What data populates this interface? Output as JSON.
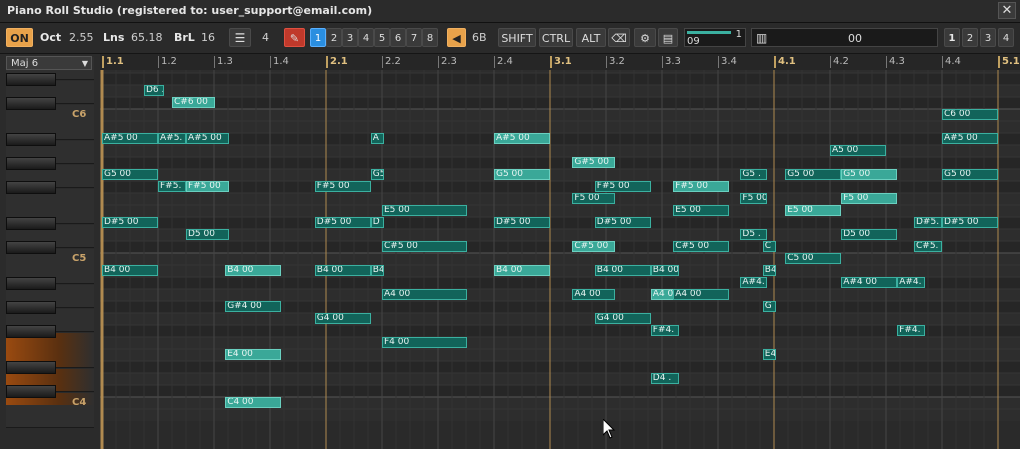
{
  "window": {
    "title": "Piano Roll Studio  (registered to: user_support@email.com)",
    "close_glyph": "✕"
  },
  "toolbar": {
    "on_label": "ON",
    "oct_label": "Oct",
    "oct_value": "2.55",
    "lns_label": "Lns",
    "lns_value": "65.18",
    "brl_label": "BrL",
    "brl_value": "16",
    "lanes_value": "4",
    "pencil_icon": "pencil-icon",
    "tracks": [
      "1",
      "2",
      "3",
      "4",
      "5",
      "6",
      "7",
      "8"
    ],
    "selected_track": "1",
    "speaker_value": "6B",
    "modifiers": [
      "SHIFT",
      "CTRL",
      "ALT"
    ],
    "position_value": "09",
    "position_top": "1",
    "pattern_value": "00",
    "views": [
      "1",
      "2",
      "3",
      "4"
    ],
    "selected_view": "1"
  },
  "keyboard": {
    "scale": "Maj 6",
    "labels": [
      "C6",
      "C5",
      "C4"
    ]
  },
  "ruler": [
    "1.1",
    "1.2",
    "1.3",
    "1.4",
    "2.1",
    "2.2",
    "2.3",
    "2.4",
    "3.1",
    "3.2",
    "3.3",
    "3.4",
    "4.1",
    "4.2",
    "4.3",
    "4.4",
    "5.1"
  ],
  "notes": [
    {
      "label": "D6 .",
      "pitch": "D6",
      "start": 1.1875,
      "len": 0.09
    },
    {
      "label": "C#6 00",
      "pitch": "C#6",
      "start": 1.3125,
      "len": 0.19
    },
    {
      "label": "C6 00",
      "pitch": "C6",
      "start": 4.75,
      "len": 0.25
    },
    {
      "label": "A#5 00",
      "pitch": "A#5",
      "start": 1.0,
      "len": 0.25
    },
    {
      "label": "A#5.",
      "pitch": "A#5",
      "start": 1.25,
      "len": 0.125
    },
    {
      "label": "A#5 00",
      "pitch": "A#5",
      "start": 1.375,
      "len": 0.19
    },
    {
      "label": "A",
      "pitch": "A#5",
      "start": 2.2,
      "len": 0.06
    },
    {
      "label": "A#5 00",
      "pitch": "A#5",
      "start": 2.75,
      "len": 0.25
    },
    {
      "label": "A#5 00",
      "pitch": "A#5",
      "start": 4.75,
      "len": 0.25
    },
    {
      "label": "A5 00",
      "pitch": "A5",
      "start": 4.25,
      "len": 0.25
    },
    {
      "label": "G#5 00",
      "pitch": "G#5",
      "start": 3.1,
      "len": 0.19
    },
    {
      "label": "G5 00",
      "pitch": "G5",
      "start": 1.0,
      "len": 0.25
    },
    {
      "label": "G5",
      "pitch": "G5",
      "start": 2.2,
      "len": 0.06
    },
    {
      "label": "G5 00",
      "pitch": "G5",
      "start": 2.75,
      "len": 0.25
    },
    {
      "label": "G5 .",
      "pitch": "G5",
      "start": 3.85,
      "len": 0.12
    },
    {
      "label": "G5 00",
      "pitch": "G5",
      "start": 4.05,
      "len": 0.25
    },
    {
      "label": "G5 00",
      "pitch": "G5",
      "start": 4.3,
      "len": 0.25
    },
    {
      "label": "G5 00",
      "pitch": "G5",
      "start": 4.75,
      "len": 0.25
    },
    {
      "label": "F#5.",
      "pitch": "F#5",
      "start": 1.25,
      "len": 0.125
    },
    {
      "label": "F#5 00",
      "pitch": "F#5",
      "start": 1.375,
      "len": 0.19
    },
    {
      "label": "F#5 00",
      "pitch": "F#5",
      "start": 1.95,
      "len": 0.25
    },
    {
      "label": "F#5 00",
      "pitch": "F#5",
      "start": 3.2,
      "len": 0.25
    },
    {
      "label": "F#5 00",
      "pitch": "F#5",
      "start": 3.55,
      "len": 0.25
    },
    {
      "label": "F5 00",
      "pitch": "F5",
      "start": 3.1,
      "len": 0.19
    },
    {
      "label": "F5 00",
      "pitch": "F5",
      "start": 3.85,
      "len": 0.12
    },
    {
      "label": "F5 00",
      "pitch": "F5",
      "start": 4.3,
      "len": 0.25
    },
    {
      "label": "E5 00",
      "pitch": "E5",
      "start": 2.25,
      "len": 0.38
    },
    {
      "label": "E5 00",
      "pitch": "E5",
      "start": 3.55,
      "len": 0.25
    },
    {
      "label": "E5 00",
      "pitch": "E5",
      "start": 4.05,
      "len": 0.25
    },
    {
      "label": "D#5 00",
      "pitch": "D#5",
      "start": 1.0,
      "len": 0.25
    },
    {
      "label": "D#5 00",
      "pitch": "D#5",
      "start": 1.95,
      "len": 0.25
    },
    {
      "label": "D",
      "pitch": "D#5",
      "start": 2.2,
      "len": 0.06
    },
    {
      "label": "D#5 00",
      "pitch": "D#5",
      "start": 2.75,
      "len": 0.25
    },
    {
      "label": "D#5 00",
      "pitch": "D#5",
      "start": 3.2,
      "len": 0.25
    },
    {
      "label": "D#5.",
      "pitch": "D#5",
      "start": 4.625,
      "len": 0.125
    },
    {
      "label": "D#5 00",
      "pitch": "D#5",
      "start": 4.75,
      "len": 0.25
    },
    {
      "label": "D5 00",
      "pitch": "D5",
      "start": 1.375,
      "len": 0.19
    },
    {
      "label": "D5 .",
      "pitch": "D5",
      "start": 3.85,
      "len": 0.12
    },
    {
      "label": "D5 00",
      "pitch": "D5",
      "start": 4.3,
      "len": 0.25
    },
    {
      "label": "C#5 00",
      "pitch": "C#5",
      "start": 2.25,
      "len": 0.38
    },
    {
      "label": "C#5 00",
      "pitch": "C#5",
      "start": 3.1,
      "len": 0.19
    },
    {
      "label": "C#5 00",
      "pitch": "C#5",
      "start": 3.55,
      "len": 0.25
    },
    {
      "label": "C",
      "pitch": "C#5",
      "start": 3.95,
      "len": 0.06
    },
    {
      "label": "C#5.",
      "pitch": "C#5",
      "start": 4.625,
      "len": 0.125
    },
    {
      "label": "C5 00",
      "pitch": "C5",
      "start": 4.05,
      "len": 0.25
    },
    {
      "label": "B4 00",
      "pitch": "B4",
      "start": 1.0,
      "len": 0.25
    },
    {
      "label": "B4 00",
      "pitch": "B4",
      "start": 1.55,
      "len": 0.25
    },
    {
      "label": "B4 00",
      "pitch": "B4",
      "start": 1.95,
      "len": 0.25
    },
    {
      "label": "B4",
      "pitch": "B4",
      "start": 2.2,
      "len": 0.06
    },
    {
      "label": "B4 00",
      "pitch": "B4",
      "start": 2.75,
      "len": 0.25
    },
    {
      "label": "B4 00",
      "pitch": "B4",
      "start": 3.2,
      "len": 0.25
    },
    {
      "label": "B4 00",
      "pitch": "B4",
      "start": 3.45,
      "len": 0.125
    },
    {
      "label": "B4",
      "pitch": "B4",
      "start": 3.95,
      "len": 0.06
    },
    {
      "label": "A#4.",
      "pitch": "A#4",
      "start": 3.85,
      "len": 0.12
    },
    {
      "label": "A#4 00",
      "pitch": "A#4",
      "start": 4.3,
      "len": 0.25
    },
    {
      "label": "A#4.",
      "pitch": "A#4",
      "start": 4.55,
      "len": 0.125
    },
    {
      "label": "A4 00",
      "pitch": "A4",
      "start": 2.25,
      "len": 0.38
    },
    {
      "label": "A4 00",
      "pitch": "A4",
      "start": 3.1,
      "len": 0.19
    },
    {
      "label": "A4 00",
      "pitch": "A4",
      "start": 3.45,
      "len": 0.125
    },
    {
      "label": "A4 00",
      "pitch": "A4",
      "start": 3.55,
      "len": 0.25
    },
    {
      "label": "G#4 00",
      "pitch": "G#4",
      "start": 1.55,
      "len": 0.25
    },
    {
      "label": "G",
      "pitch": "G#4",
      "start": 3.95,
      "len": 0.06
    },
    {
      "label": "G4 00",
      "pitch": "G4",
      "start": 1.95,
      "len": 0.25
    },
    {
      "label": "G4 00",
      "pitch": "G4",
      "start": 3.2,
      "len": 0.25
    },
    {
      "label": "F#4.",
      "pitch": "F#4",
      "start": 3.45,
      "len": 0.125
    },
    {
      "label": "F#4.",
      "pitch": "F#4",
      "start": 4.55,
      "len": 0.125
    },
    {
      "label": "F4 00",
      "pitch": "F4",
      "start": 2.25,
      "len": 0.38
    },
    {
      "label": "E4 00",
      "pitch": "E4",
      "start": 1.55,
      "len": 0.25
    },
    {
      "label": "E4",
      "pitch": "E4",
      "start": 3.95,
      "len": 0.06
    },
    {
      "label": "D4 .",
      "pitch": "D4",
      "start": 3.45,
      "len": 0.125
    },
    {
      "label": "C4 00",
      "pitch": "C4",
      "start": 1.55,
      "len": 0.25
    }
  ],
  "colors": {
    "note": "#12645a",
    "note_light": "#3aa898",
    "accent": "#e8a24a",
    "selected": "#2a8ee0"
  }
}
